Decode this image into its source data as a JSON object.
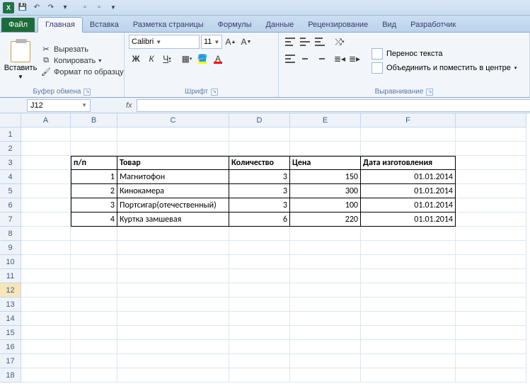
{
  "qat": {
    "save_title": "Сохранить",
    "undo_title": "Отменить",
    "redo_title": "Повторить"
  },
  "tabs": {
    "file": "Файл",
    "home": "Главная",
    "insert": "Вставка",
    "pagelayout": "Разметка страницы",
    "formulas": "Формулы",
    "data": "Данные",
    "review": "Рецензирование",
    "view": "Вид",
    "developer": "Разработчик"
  },
  "clipboard": {
    "paste": "Вставить",
    "cut": "Вырезать",
    "copy": "Копировать",
    "format_painter": "Формат по образцу",
    "group_label": "Буфер обмена"
  },
  "font": {
    "name": "Calibri",
    "size": "11",
    "group_label": "Шрифт",
    "bold": "Ж",
    "italic": "К",
    "underline": "Ч"
  },
  "alignment": {
    "wrap": "Перенос текста",
    "merge": "Объединить и поместить в центре",
    "group_label": "Выравнивание"
  },
  "namebox": {
    "value": "J12"
  },
  "columns": [
    "A",
    "B",
    "C",
    "D",
    "E",
    "F"
  ],
  "col_widths": {
    "A": 70,
    "B": 66,
    "C": 158,
    "D": 86,
    "E": 100,
    "F": 134
  },
  "row_count": 18,
  "selected_row": 12,
  "table": {
    "headers": {
      "pp": "п/п",
      "tovar": "Товар",
      "qty": "Количество",
      "price": "Цена",
      "date": "Дата изготовления"
    },
    "rows": [
      {
        "pp": "1",
        "tovar": "Магнитофон",
        "qty": "3",
        "price": "150",
        "date": "01.01.2014"
      },
      {
        "pp": "2",
        "tovar": "Кинокамера",
        "qty": "3",
        "price": "300",
        "date": "01.01.2014"
      },
      {
        "pp": "3",
        "tovar": "Портсигар(отечественный)",
        "qty": "3",
        "price": "100",
        "date": "01.01.2014"
      },
      {
        "pp": "4",
        "tovar": "Куртка замшевая",
        "qty": "6",
        "price": "220",
        "date": "01.01.2014"
      }
    ]
  }
}
